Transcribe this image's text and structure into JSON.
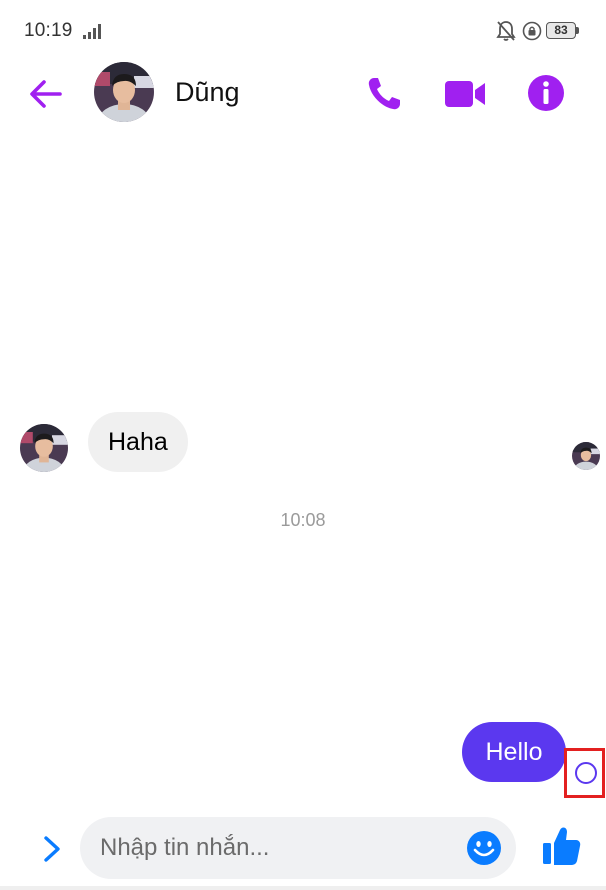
{
  "status_bar": {
    "time": "10:19",
    "battery": "83",
    "icons": [
      "signal-icon",
      "bell-off-icon",
      "lock-rotation-icon",
      "battery-icon"
    ]
  },
  "header": {
    "contact_name": "Dũng",
    "accent_color": "#a020f0",
    "actions": [
      "back-arrow-icon",
      "phone-icon",
      "video-camera-icon",
      "info-icon"
    ]
  },
  "messages": {
    "incoming": "Haha",
    "timestamp": "10:08",
    "outgoing": "Hello",
    "outgoing_color": "#5b38ef"
  },
  "composer": {
    "placeholder": "Nhập tin nhắn...",
    "value": "",
    "icons": [
      "chevron-right-icon",
      "emoji-icon",
      "thumbs-up-icon"
    ],
    "icon_color": "#0a7cff"
  }
}
